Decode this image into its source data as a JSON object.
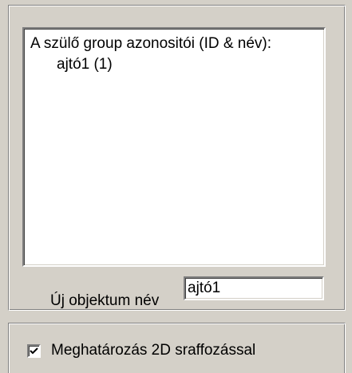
{
  "parent_group": {
    "heading": "A szülő group azonositói (ID & név):",
    "items": [
      "ajtó1 (1)"
    ]
  },
  "new_object": {
    "label": "Új objektum név",
    "value": "ajtó1"
  },
  "hatching": {
    "label": "Meghatározás 2D sraffozással",
    "checked": true
  }
}
